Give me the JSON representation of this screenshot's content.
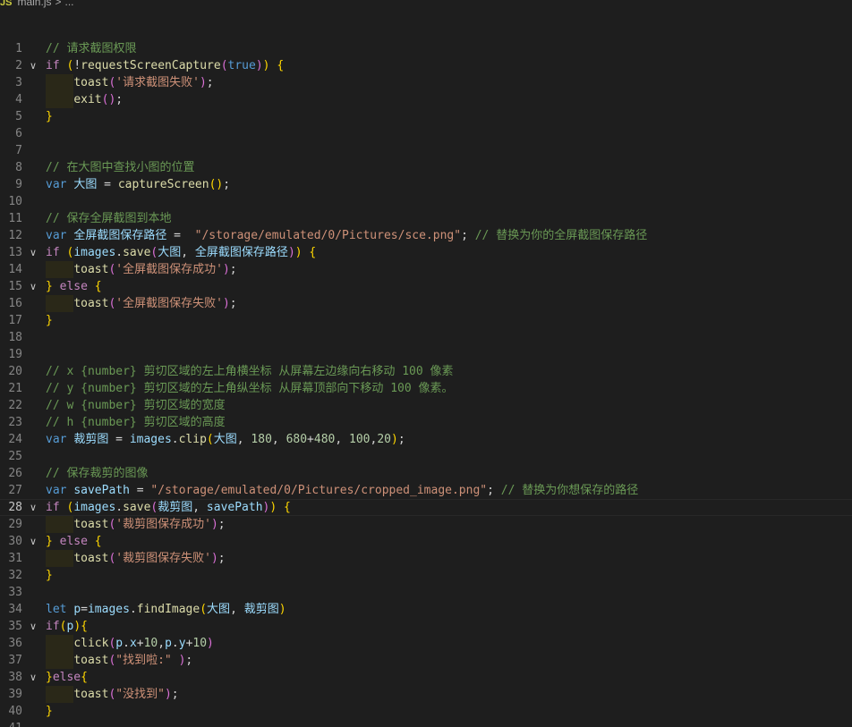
{
  "breadcrumb": {
    "file_icon": "JS",
    "file_name": "main.js",
    "separator": ">",
    "trailing": "..."
  },
  "editor": {
    "language": "javascript",
    "current_line": 28,
    "fold_markers": [
      2,
      13,
      15,
      28,
      30,
      35,
      38
    ],
    "lines": [
      {
        "n": "1",
        "tokens": [
          [
            "c-comment",
            "// 请求截图权限"
          ]
        ]
      },
      {
        "n": "2",
        "tokens": [
          [
            "c-ctrl",
            "if"
          ],
          [
            "c-plain",
            " "
          ],
          [
            "b1",
            "("
          ],
          [
            "c-plain",
            "!"
          ],
          [
            "c-fn",
            "requestScreenCapture"
          ],
          [
            "b2",
            "("
          ],
          [
            "c-kw",
            "true"
          ],
          [
            "b2",
            ")"
          ],
          [
            "b1",
            ")"
          ],
          [
            "c-plain",
            " "
          ],
          [
            "b1",
            "{"
          ]
        ]
      },
      {
        "n": "3",
        "indent": 1,
        "tokens": [
          [
            "c-fn",
            "toast"
          ],
          [
            "b2",
            "("
          ],
          [
            "c-str",
            "'请求截图失败'"
          ],
          [
            "b2",
            ")"
          ],
          [
            "c-plain",
            ";"
          ]
        ]
      },
      {
        "n": "4",
        "indent": 1,
        "tokens": [
          [
            "c-fn",
            "exit"
          ],
          [
            "b2",
            "()"
          ],
          [
            "c-plain",
            ";"
          ]
        ]
      },
      {
        "n": "5",
        "tokens": [
          [
            "b1",
            "}"
          ]
        ]
      },
      {
        "n": "6",
        "tokens": []
      },
      {
        "n": "7",
        "tokens": []
      },
      {
        "n": "8",
        "tokens": [
          [
            "c-comment",
            "// 在大图中查找小图的位置"
          ]
        ]
      },
      {
        "n": "9",
        "tokens": [
          [
            "c-kw",
            "var"
          ],
          [
            "c-plain",
            " "
          ],
          [
            "c-var",
            "大图"
          ],
          [
            "c-plain",
            " = "
          ],
          [
            "c-fn",
            "captureScreen"
          ],
          [
            "b1",
            "()"
          ],
          [
            "c-plain",
            ";"
          ]
        ]
      },
      {
        "n": "10",
        "tokens": []
      },
      {
        "n": "11",
        "tokens": [
          [
            "c-comment",
            "// 保存全屏截图到本地"
          ]
        ]
      },
      {
        "n": "12",
        "tokens": [
          [
            "c-kw",
            "var"
          ],
          [
            "c-plain",
            " "
          ],
          [
            "c-var",
            "全屏截图保存路径"
          ],
          [
            "c-plain",
            " =  "
          ],
          [
            "c-str",
            "\"/storage/emulated/0/Pictures/sce.png\""
          ],
          [
            "c-plain",
            "; "
          ],
          [
            "c-comment",
            "// 替换为你的全屏截图保存路径"
          ]
        ]
      },
      {
        "n": "13",
        "tokens": [
          [
            "c-ctrl",
            "if"
          ],
          [
            "c-plain",
            " "
          ],
          [
            "b1",
            "("
          ],
          [
            "c-var",
            "images"
          ],
          [
            "c-plain",
            "."
          ],
          [
            "c-fn",
            "save"
          ],
          [
            "b2",
            "("
          ],
          [
            "c-var",
            "大图"
          ],
          [
            "c-plain",
            ", "
          ],
          [
            "c-var",
            "全屏截图保存路径"
          ],
          [
            "b2",
            ")"
          ],
          [
            "b1",
            ")"
          ],
          [
            "c-plain",
            " "
          ],
          [
            "b1",
            "{"
          ]
        ]
      },
      {
        "n": "14",
        "indent": 1,
        "tokens": [
          [
            "c-fn",
            "toast"
          ],
          [
            "b2",
            "("
          ],
          [
            "c-str",
            "'全屏截图保存成功'"
          ],
          [
            "b2",
            ")"
          ],
          [
            "c-plain",
            ";"
          ]
        ]
      },
      {
        "n": "15",
        "tokens": [
          [
            "b1",
            "}"
          ],
          [
            "c-plain",
            " "
          ],
          [
            "c-ctrl",
            "else"
          ],
          [
            "c-plain",
            " "
          ],
          [
            "b1",
            "{"
          ]
        ]
      },
      {
        "n": "16",
        "indent": 1,
        "tokens": [
          [
            "c-fn",
            "toast"
          ],
          [
            "b2",
            "("
          ],
          [
            "c-str",
            "'全屏截图保存失败'"
          ],
          [
            "b2",
            ")"
          ],
          [
            "c-plain",
            ";"
          ]
        ]
      },
      {
        "n": "17",
        "tokens": [
          [
            "b1",
            "}"
          ]
        ]
      },
      {
        "n": "18",
        "tokens": []
      },
      {
        "n": "19",
        "tokens": []
      },
      {
        "n": "20",
        "tokens": [
          [
            "c-comment",
            "// x {number} 剪切区域的左上角横坐标 从屏幕左边缘向右移动 100 像素"
          ]
        ]
      },
      {
        "n": "21",
        "tokens": [
          [
            "c-comment",
            "// y {number} 剪切区域的左上角纵坐标 从屏幕顶部向下移动 100 像素。"
          ]
        ]
      },
      {
        "n": "22",
        "tokens": [
          [
            "c-comment",
            "// w {number} 剪切区域的宽度"
          ]
        ]
      },
      {
        "n": "23",
        "tokens": [
          [
            "c-comment",
            "// h {number} 剪切区域的高度"
          ]
        ]
      },
      {
        "n": "24",
        "tokens": [
          [
            "c-kw",
            "var"
          ],
          [
            "c-plain",
            " "
          ],
          [
            "c-var",
            "裁剪图"
          ],
          [
            "c-plain",
            " = "
          ],
          [
            "c-var",
            "images"
          ],
          [
            "c-plain",
            "."
          ],
          [
            "c-fn",
            "clip"
          ],
          [
            "b1",
            "("
          ],
          [
            "c-var",
            "大图"
          ],
          [
            "c-plain",
            ", "
          ],
          [
            "c-num",
            "180"
          ],
          [
            "c-plain",
            ", "
          ],
          [
            "c-num",
            "680"
          ],
          [
            "c-plain",
            "+"
          ],
          [
            "c-num",
            "480"
          ],
          [
            "c-plain",
            ", "
          ],
          [
            "c-num",
            "100"
          ],
          [
            "c-plain",
            ","
          ],
          [
            "c-num",
            "20"
          ],
          [
            "b1",
            ")"
          ],
          [
            "c-plain",
            ";"
          ]
        ]
      },
      {
        "n": "25",
        "tokens": []
      },
      {
        "n": "26",
        "tokens": [
          [
            "c-comment",
            "// 保存裁剪的图像"
          ]
        ]
      },
      {
        "n": "27",
        "tokens": [
          [
            "c-kw",
            "var"
          ],
          [
            "c-plain",
            " "
          ],
          [
            "c-var",
            "savePath"
          ],
          [
            "c-plain",
            " = "
          ],
          [
            "c-str",
            "\"/storage/emulated/0/Pictures/cropped_image.png\""
          ],
          [
            "c-plain",
            "; "
          ],
          [
            "c-comment",
            "// 替换为你想保存的路径"
          ]
        ]
      },
      {
        "n": "28",
        "tokens": [
          [
            "c-ctrl",
            "if"
          ],
          [
            "c-plain",
            " "
          ],
          [
            "b1",
            "("
          ],
          [
            "c-var",
            "images"
          ],
          [
            "c-plain",
            "."
          ],
          [
            "c-fn",
            "save"
          ],
          [
            "b2",
            "("
          ],
          [
            "c-var",
            "裁剪图"
          ],
          [
            "c-plain",
            ", "
          ],
          [
            "c-var",
            "savePath"
          ],
          [
            "b2",
            ")"
          ],
          [
            "b1",
            ")"
          ],
          [
            "c-plain",
            " "
          ],
          [
            "b1",
            "{"
          ]
        ]
      },
      {
        "n": "29",
        "indent": 1,
        "tokens": [
          [
            "c-fn",
            "toast"
          ],
          [
            "b2",
            "("
          ],
          [
            "c-str",
            "'裁剪图保存成功'"
          ],
          [
            "b2",
            ")"
          ],
          [
            "c-plain",
            ";"
          ]
        ]
      },
      {
        "n": "30",
        "tokens": [
          [
            "b1",
            "}"
          ],
          [
            "c-plain",
            " "
          ],
          [
            "c-ctrl",
            "else"
          ],
          [
            "c-plain",
            " "
          ],
          [
            "b1",
            "{"
          ]
        ]
      },
      {
        "n": "31",
        "indent": 1,
        "tokens": [
          [
            "c-fn",
            "toast"
          ],
          [
            "b2",
            "("
          ],
          [
            "c-str",
            "'裁剪图保存失败'"
          ],
          [
            "b2",
            ")"
          ],
          [
            "c-plain",
            ";"
          ]
        ]
      },
      {
        "n": "32",
        "tokens": [
          [
            "b1",
            "}"
          ]
        ]
      },
      {
        "n": "33",
        "tokens": []
      },
      {
        "n": "34",
        "tokens": [
          [
            "c-kw",
            "let"
          ],
          [
            "c-plain",
            " "
          ],
          [
            "c-var",
            "p"
          ],
          [
            "c-plain",
            "="
          ],
          [
            "c-var",
            "images"
          ],
          [
            "c-plain",
            "."
          ],
          [
            "c-fn",
            "findImage"
          ],
          [
            "b1",
            "("
          ],
          [
            "c-var",
            "大图"
          ],
          [
            "c-plain",
            ", "
          ],
          [
            "c-var",
            "裁剪图"
          ],
          [
            "b1",
            ")"
          ]
        ]
      },
      {
        "n": "35",
        "tokens": [
          [
            "c-ctrl",
            "if"
          ],
          [
            "b1",
            "("
          ],
          [
            "c-var",
            "p"
          ],
          [
            "b1",
            ")"
          ],
          [
            "b1",
            "{"
          ]
        ]
      },
      {
        "n": "36",
        "indent": 1,
        "tokens": [
          [
            "c-fn",
            "click"
          ],
          [
            "b2",
            "("
          ],
          [
            "c-var",
            "p"
          ],
          [
            "c-plain",
            "."
          ],
          [
            "c-var",
            "x"
          ],
          [
            "c-plain",
            "+"
          ],
          [
            "c-num",
            "10"
          ],
          [
            "c-plain",
            ","
          ],
          [
            "c-var",
            "p"
          ],
          [
            "c-plain",
            "."
          ],
          [
            "c-var",
            "y"
          ],
          [
            "c-plain",
            "+"
          ],
          [
            "c-num",
            "10"
          ],
          [
            "b2",
            ")"
          ]
        ]
      },
      {
        "n": "37",
        "indent": 1,
        "tokens": [
          [
            "c-fn",
            "toast"
          ],
          [
            "b2",
            "("
          ],
          [
            "c-str",
            "\"找到啦:\""
          ],
          [
            "c-plain",
            " "
          ],
          [
            "b2",
            ")"
          ],
          [
            "c-plain",
            ";"
          ]
        ]
      },
      {
        "n": "38",
        "tokens": [
          [
            "b1",
            "}"
          ],
          [
            "c-ctrl",
            "else"
          ],
          [
            "b1",
            "{"
          ]
        ]
      },
      {
        "n": "39",
        "indent": 1,
        "tokens": [
          [
            "c-fn",
            "toast"
          ],
          [
            "b2",
            "("
          ],
          [
            "c-str",
            "\"没找到\""
          ],
          [
            "b2",
            ")"
          ],
          [
            "c-plain",
            ";"
          ]
        ]
      },
      {
        "n": "40",
        "tokens": [
          [
            "b1",
            "}"
          ]
        ]
      },
      {
        "n": "41",
        "tokens": []
      }
    ]
  }
}
